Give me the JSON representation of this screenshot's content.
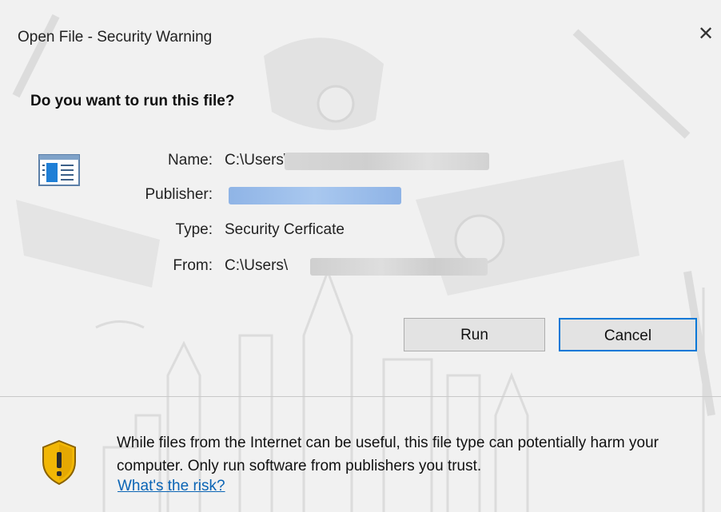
{
  "dialog": {
    "title": "Open File - Security Warning",
    "close_label": "✕",
    "question": "Do you want to run this file?"
  },
  "fields": [
    {
      "label": "Name:",
      "value": "C:\\Users\\"
    },
    {
      "label": "Publisher:",
      "value": ""
    },
    {
      "label": "Type:",
      "value": "Security Cerficate"
    },
    {
      "label": "From:",
      "value": "C:\\Users\\"
    }
  ],
  "buttons": {
    "run": "Run",
    "cancel": "Cancel"
  },
  "warning": {
    "message": "While files from the Internet can be useful, this file type can potentially harm your computer. Only run software from publishers you trust.",
    "link": "What's the risk?"
  },
  "icons": {
    "file": "application-file-icon",
    "shield": "security-shield-warning-icon",
    "close": "close-icon"
  },
  "colors": {
    "background": "#f1f1f1",
    "accent": "#0078d7",
    "link": "#0a64b5",
    "shield_yellow": "#f2b705"
  }
}
